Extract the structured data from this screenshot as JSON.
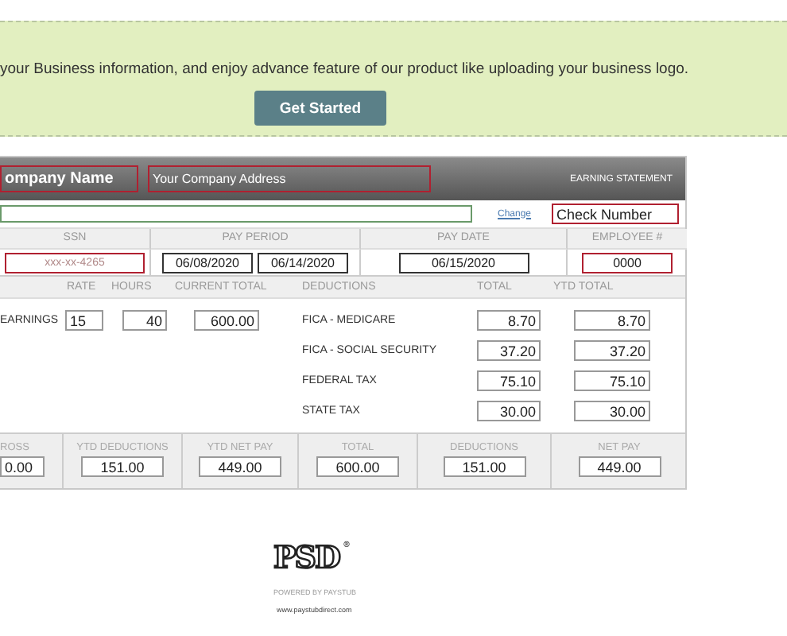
{
  "banner": {
    "message": "your Business information, and enjoy advance feature of our product like uploading your business logo.",
    "button": "Get Started"
  },
  "stub": {
    "company_name": "ompany Name",
    "company_address": "Your Company Address",
    "title": "EARNING STATEMENT",
    "change_link": "Change",
    "check_number": "Check Number",
    "info_columns": [
      {
        "heading": "SSN",
        "fields": [
          {
            "placeholder": "xxx-xx-4265"
          }
        ]
      },
      {
        "heading": "PAY PERIOD",
        "fields": [
          {
            "value": "06/08/2020"
          },
          {
            "value": "06/14/2020"
          }
        ]
      },
      {
        "heading": "PAY DATE",
        "fields": [
          {
            "value": "06/15/2020"
          }
        ]
      },
      {
        "heading": "EMPLOYEE #",
        "fields": [
          {
            "value": "0000"
          }
        ]
      }
    ],
    "earnings_columns": [
      "RATE",
      "HOURS",
      "CURRENT TOTAL",
      "DEDUCTIONS",
      "TOTAL",
      "YTD TOTAL"
    ],
    "earnings": {
      "label": "EARNINGS",
      "rate": "15",
      "hours": "40",
      "current_total": "600.00"
    },
    "deductions": [
      {
        "name": "FICA - MEDICARE",
        "total": "8.70",
        "ytd_total": "8.70"
      },
      {
        "name": "FICA - SOCIAL SECURITY",
        "total": "37.20",
        "ytd_total": "37.20"
      },
      {
        "name": "FEDERAL TAX",
        "total": "75.10",
        "ytd_total": "75.10"
      },
      {
        "name": "STATE TAX",
        "total": "30.00",
        "ytd_total": "30.00"
      }
    ],
    "summary": [
      {
        "heading": "ROSS",
        "value": "0.00"
      },
      {
        "heading": "YTD DEDUCTIONS",
        "value": "151.00"
      },
      {
        "heading": "YTD NET PAY",
        "value": "449.00"
      },
      {
        "heading": "TOTAL",
        "value": "600.00"
      },
      {
        "heading": "DEDUCTIONS",
        "value": "151.00"
      },
      {
        "heading": "NET PAY",
        "value": "449.00"
      }
    ]
  },
  "footer": {
    "logo": "PSD",
    "logo_mark": "®",
    "powered_by": "POWERED BY PAYSTUB",
    "url": "www.paystubdirect.com"
  }
}
